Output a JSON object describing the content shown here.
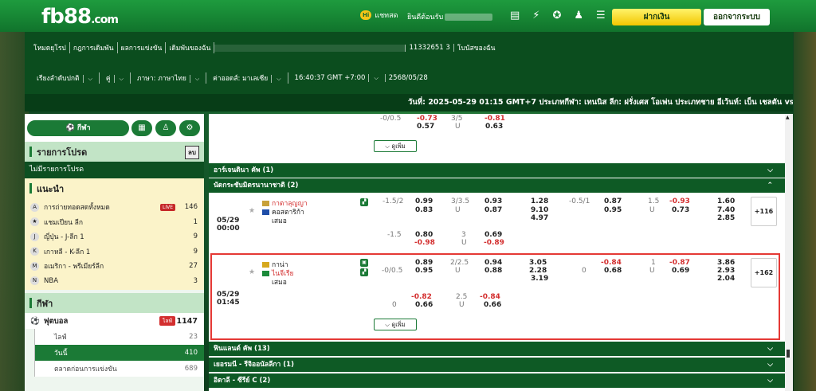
{
  "brand": {
    "logo": "fb88",
    "logo_domain": ".com"
  },
  "header": {
    "chat_badge": "Hi",
    "chat_label": "แชทสด",
    "welcome": "ยินดีต้อนรับ",
    "deposit": "ฝากเงิน",
    "logout": "ออกจากระบบ",
    "icons": [
      "wallet-icon",
      "lightning-icon",
      "vip-icon",
      "user-icon",
      "list-icon"
    ]
  },
  "nav": {
    "row1": [
      "โหมดยุโรป",
      "กฎการเดิมพัน",
      "ผลการแข่งขัน",
      "เดิมพันของฉัน",
      "11332651 3",
      "โบนัสของฉัน"
    ],
    "row2": [
      "เรียงลำดับปกติ",
      "คู่",
      "ภาษา: ภาษาไทย",
      "ค่าออดส์: มาเลเซีย",
      "16:40:37 GMT +7:00",
      "2568/05/28"
    ]
  },
  "ticker": "วันที่: 2025-05-29 01:15 GMT+7 ประเภทกีฬา: เทนนิส ลีก: ฝรั่งเศส โอเพ่น ประเภทชาย อีเว้นท์: เบ็น เชลตัน vs ฮิวโก้ แกสตัน",
  "sidebar": {
    "sport_pill": "กีฬา",
    "favorites_title": "รายการโปรด",
    "favorites_btn": "ลบ",
    "favorites_empty": "ไม่มีรายการโปรด",
    "recommended_title": "แนะนำ",
    "recommended": [
      {
        "label": "การถ่ายทอดสดทั้งหมด",
        "count": "146",
        "live": "LIVE"
      },
      {
        "label": "แชมเปียน ลีก",
        "count": "1"
      },
      {
        "label": "ญี่ปุ่น - J-ลีก 1",
        "count": "9"
      },
      {
        "label": "เกาหลี - K-ลีก 1",
        "count": "9"
      },
      {
        "label": "อเมริกา - พรีเมียร์ลีก",
        "count": "27"
      },
      {
        "label": "NBA",
        "count": "3"
      }
    ],
    "sports_title": "กีฬา",
    "football": {
      "label": "ฟุตบอล",
      "live": "ไลฟ์",
      "count": "1147"
    },
    "sub": [
      {
        "label": "ไลฟ์",
        "count": "23"
      },
      {
        "label": "วันนี้",
        "count": "410"
      },
      {
        "label": "ตลาดก่อนการแข่งขัน",
        "count": "689"
      }
    ]
  },
  "top_match": {
    "hdp": "-0/0.5",
    "h1": "-0.73",
    "h2": "0.57",
    "ou": "3/5",
    "ou_u": "U",
    "o1": "-0.81",
    "o2": "0.63",
    "more": "ดูเพิ่ม"
  },
  "leagues": {
    "argentina": "อาร์เจนตินา คัพ (1)",
    "intl": "นัดกระชับมิตรนานาชาติ (2)",
    "finland": "ฟินแลนด์ คัพ (13)",
    "germany": "เยอรมนี - รีจิออนัลลีกา (1)",
    "italy": "อิตาลี - ซีรีย์ C (2)"
  },
  "match1": {
    "home": "กาตาลุญญา",
    "away": "คอสตาริก้า",
    "draw": "เสมอ",
    "date": "05/29",
    "time": "00:00",
    "hdp": "-1.5/2",
    "h1": "0.99",
    "h2": "0.83",
    "ou": "3/3.5",
    "ou_u": "U",
    "o1": "0.93",
    "o2": "0.87",
    "x1": "1.28",
    "x2": "9.10",
    "x3": "4.97",
    "hhdp": "-0.5/1",
    "hh1": "0.87",
    "hh2": "0.95",
    "hou": "1.5",
    "hou_u": "U",
    "ho1": "-0.93",
    "ho2": "0.73",
    "hx1": "1.60",
    "hx2": "7.40",
    "hx3": "2.85",
    "more": "+116",
    "r2_hdp": "-1.5",
    "r2_h1": "0.80",
    "r2_h2": "-0.98",
    "r2_ou": "3",
    "r2_u": "U",
    "r2_o1": "0.69",
    "r2_o2": "-0.89"
  },
  "match2": {
    "home": "กาน่า",
    "away": "ไนจีเรีย",
    "draw": "เสมอ",
    "date": "05/29",
    "time": "01:45",
    "hdp": "-0/0.5",
    "h1": "0.89",
    "h2": "0.95",
    "ou": "2/2.5",
    "ou_u": "U",
    "o1": "0.94",
    "o2": "0.88",
    "x1": "3.05",
    "x2": "2.28",
    "x3": "3.19",
    "hhdp": "0",
    "hh1": "-0.84",
    "hh2": "0.68",
    "hou": "1",
    "hou_u": "U",
    "ho1": "-0.87",
    "ho2": "0.69",
    "hx1": "3.86",
    "hx2": "2.93",
    "hx3": "2.04",
    "more": "+162",
    "r2_hdp": "0",
    "r2_h1": "-0.82",
    "r2_h2": "0.66",
    "r2_ou": "2.5",
    "r2_u": "U",
    "r2_o1": "-0.84",
    "r2_o2": "0.66",
    "more_btn": "ดูเพิ่ม"
  },
  "colors": {
    "brand_green": "#1b7a36",
    "accent_yellow": "#f2c600",
    "negative": "#d32f2f"
  }
}
